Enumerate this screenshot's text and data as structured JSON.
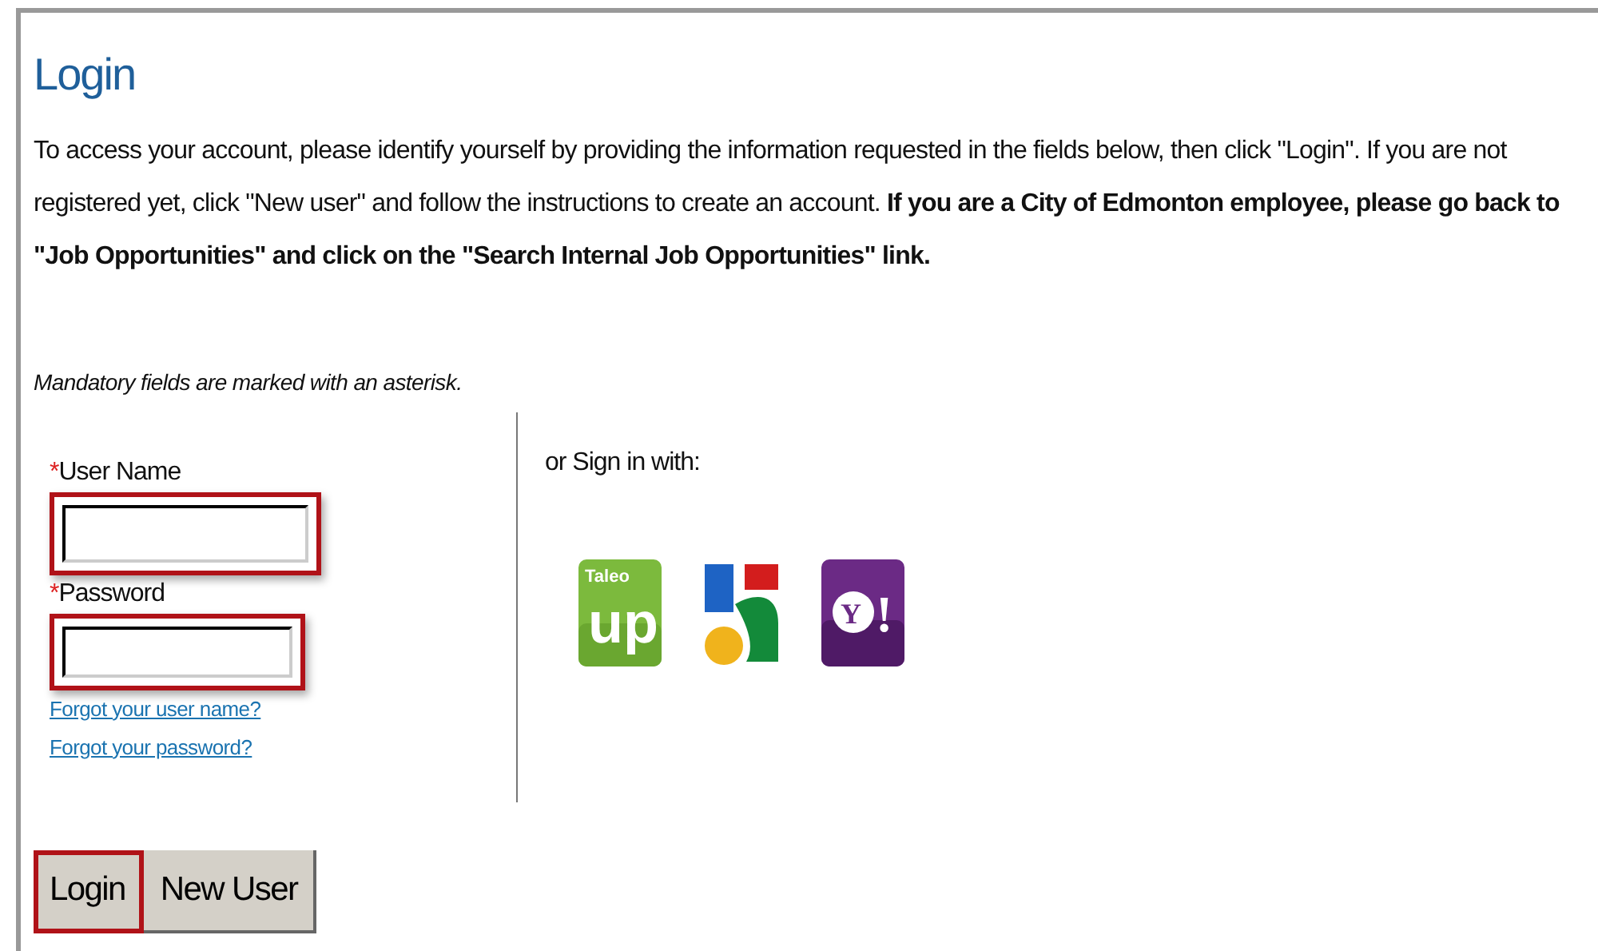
{
  "title": "Login",
  "intro": "To access your account, please identify yourself by providing the information requested in the fields below, then click \"Login\". If you are not registered yet, click \"New user\" and follow the instructions to create an account. **If you are a City of Edmonton employee, please go back to \"Job Opportunities\" and click on the \"Search Internal Job Opportunities\" link.**",
  "mandatory_note": "Mandatory fields are marked with an asterisk.",
  "fields": [
    {
      "label": "User Name",
      "required_mark": "*",
      "highlighted": true
    },
    {
      "label": "Password",
      "required_mark": "*",
      "highlighted": true
    }
  ],
  "links": [
    "Forgot your user name?",
    "Forgot your password?"
  ],
  "sign_in_with": {
    "label": "or Sign in with:",
    "providers": [
      {
        "kind": "taleo",
        "label": "Taleo",
        "mark": "up"
      },
      {
        "kind": "google"
      },
      {
        "kind": "yahoo",
        "mark": "Y!"
      }
    ]
  },
  "buttons": [
    {
      "label": "Login",
      "highlighted": true
    },
    {
      "label": "New User",
      "highlighted": false
    }
  ]
}
